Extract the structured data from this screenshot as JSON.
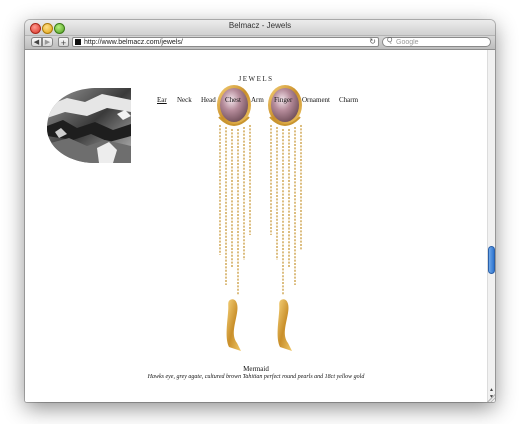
{
  "window": {
    "title": "Belmacz - Jewels"
  },
  "toolbar": {
    "back_icon": "◀",
    "forward_icon": "▶",
    "add_icon": "+",
    "url": "http://www.belmacz.com/jewels/",
    "reload_icon": "↻",
    "search_placeholder": "Google",
    "search_icon": "Q"
  },
  "site": {
    "title": "JEWELS",
    "nav": [
      {
        "label": "Ear",
        "active": true
      },
      {
        "label": "Neck"
      },
      {
        "label": "Head"
      },
      {
        "label": "Chest"
      },
      {
        "label": "Arm"
      },
      {
        "label": "Finger"
      },
      {
        "label": "Ornament"
      },
      {
        "label": "Charm"
      }
    ]
  },
  "product": {
    "name": "Mermaid",
    "description": "Hawks eye, grey agate, cultured brown Tahitian perfect round pearls and 18ct yellow gold"
  },
  "colors": {
    "gold": "#d4a03c",
    "pearl": "#b08a98",
    "scroll_accent": "#2e74d0"
  }
}
